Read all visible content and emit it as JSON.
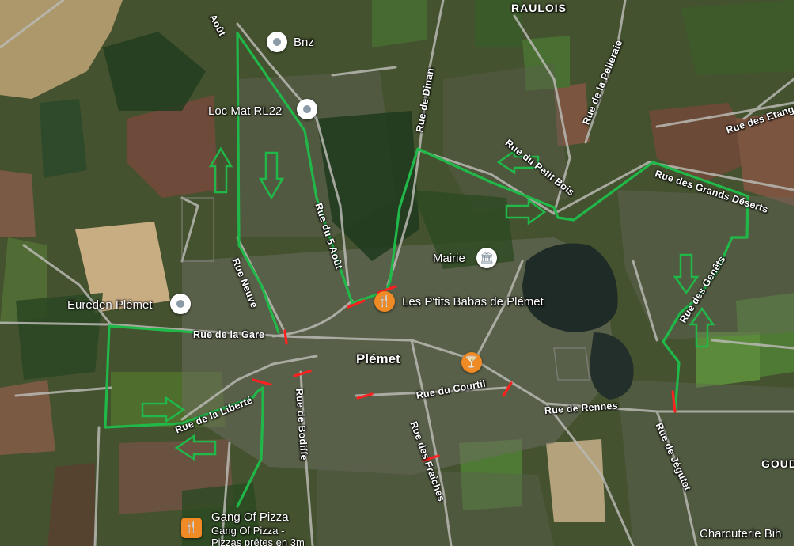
{
  "map": {
    "town": "Plémet",
    "districts": {
      "raulois": "RAULOIS",
      "goud": "GOUD"
    },
    "streets": {
      "aout_top": "Août",
      "rue_neuve": "Rue Neuve",
      "rue_du_aout": "Rue du 5 Août",
      "rue_de_dinan": "Rue de Dinan",
      "rue_du_petit_bois": "Rue du Petit Bois",
      "rue_de_la_pelleraie": "Rue de la Pelleraie",
      "rue_des_etangs": "Rue des Etangs",
      "rue_des_grands_deserts": "Rue des Grands Déserts",
      "rue_des_genets": "Rue des Genêts",
      "rue_de_la_gare": "Rue de la Gare",
      "rue_de_la_liberte": "Rue de la Liberté",
      "rue_de_bodiffe": "Rue de Bodiffe",
      "rue_du_courtil": "Rue du Courtil",
      "rue_des_fraiches": "Rue des Fraîches",
      "rue_de_rennes": "Rue de Rennes",
      "rue_de_jegutet": "Rue de Jégutet"
    },
    "pois": {
      "bnz": "Bnz",
      "loc_mat": "Loc Mat RL22",
      "mairie": "Mairie",
      "eureden": "Eureden Plémet",
      "babas": "Les P'tits Babas de Plémet",
      "gang": "Gang Of Pizza",
      "gang_sub1": "Gang Of Pizza -",
      "gang_sub2": "Pizzas prêtes en 3m",
      "charcuterie": "Charcuterie Bih"
    },
    "icons": {
      "generic_pin": "location-pin-icon",
      "restaurant": "fork-knife-icon",
      "bar": "cocktail-icon",
      "town_hall": "town-hall-icon"
    },
    "colors": {
      "route": "#21b84a",
      "closure": "#ff2020",
      "poi_orange": "#f08a24",
      "poi_gray": "#8a9aa6"
    }
  }
}
